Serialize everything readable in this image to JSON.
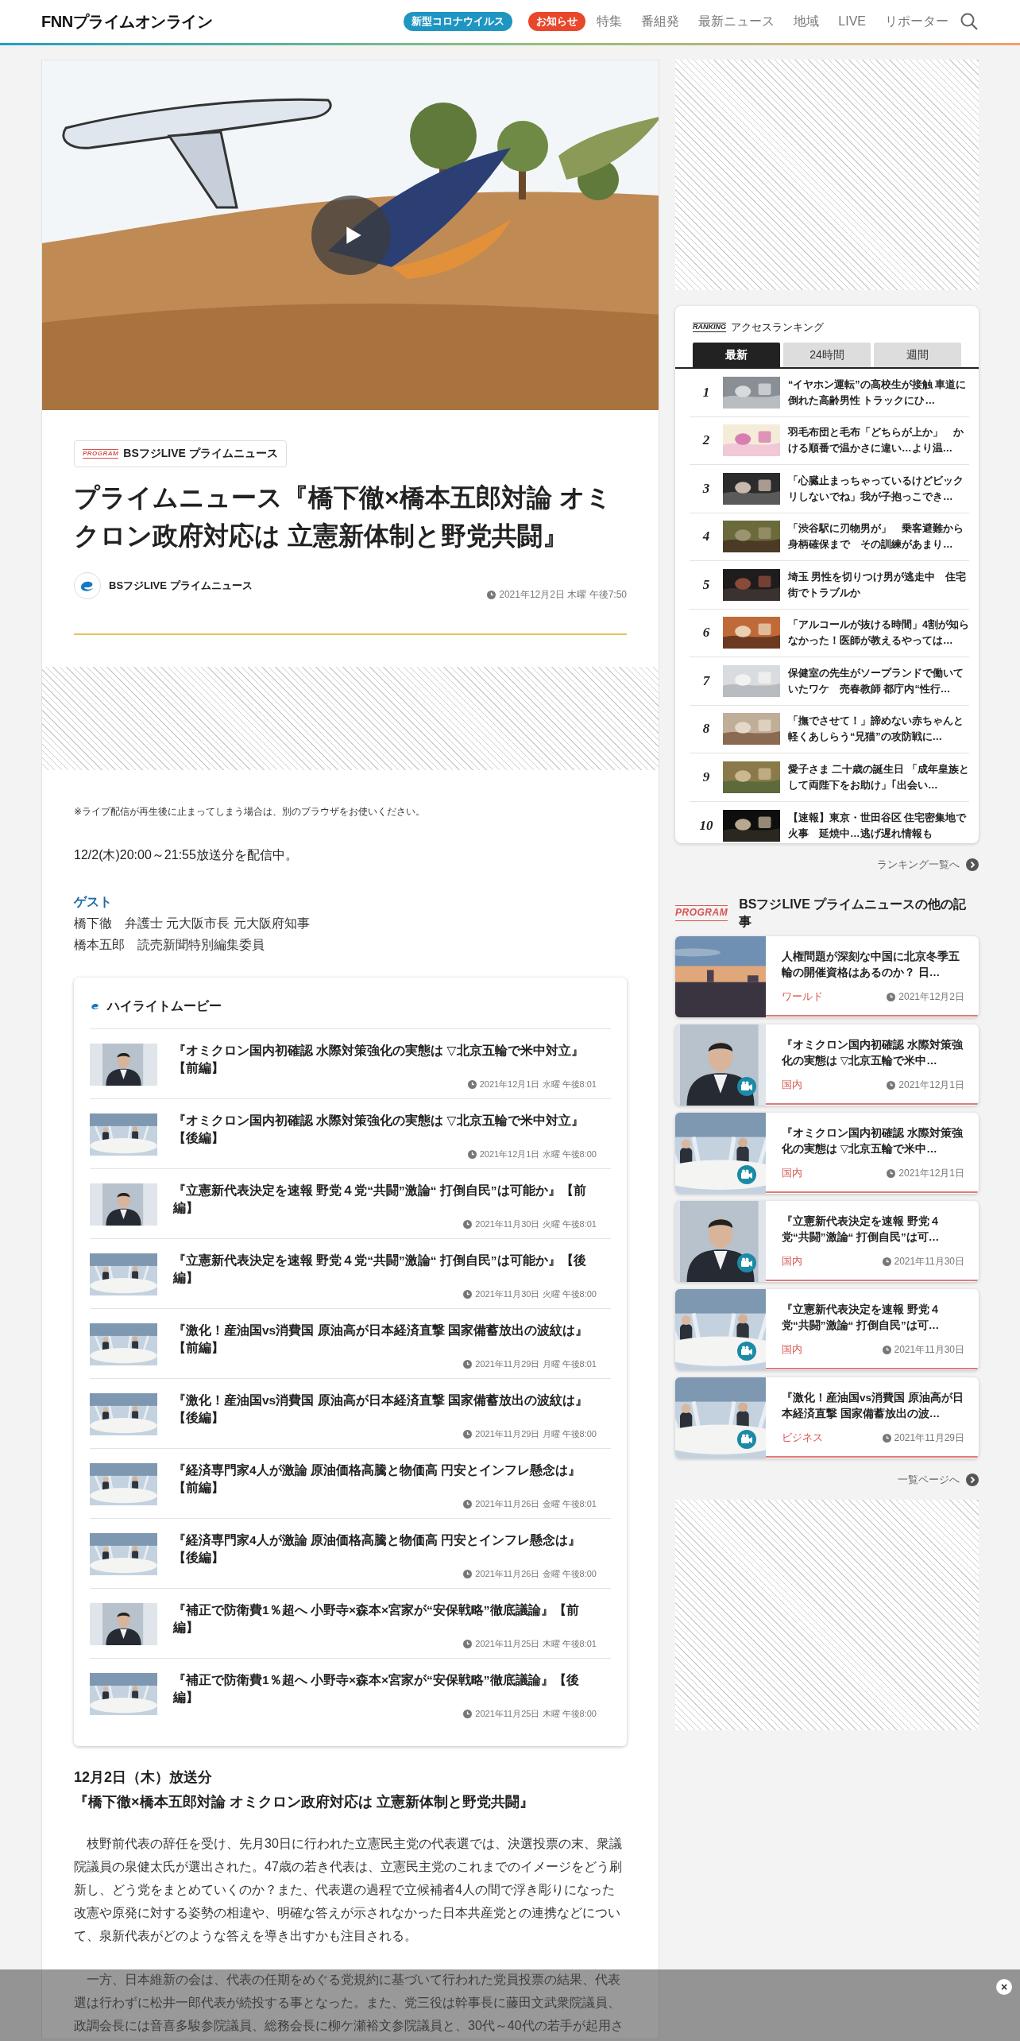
{
  "header": {
    "logo": "FNNプライムオンライン",
    "badges": [
      {
        "label": "新型コロナウイルス",
        "color": "#1f95c2"
      },
      {
        "label": "お知らせ",
        "color": "#e9472b"
      }
    ],
    "nav": [
      "特集",
      "番組発",
      "最新ニュース",
      "地域",
      "LIVE",
      "リポーター"
    ]
  },
  "article": {
    "program_badge": "PROGRAM",
    "program_name": "BSフジLIVE プライムニュース",
    "title": "プライムニュース『橋下徹×橋本五郎対論 オミクロン政府対応は 立憲新体制と野党共闘』",
    "author": "BSフジLIVE プライムニュース",
    "date": "2021年12月2日 木曜 午後7:50",
    "notice": "※ライブ配信が再生後に止まってしまう場合は、別のブラウザをお使いください。",
    "broadcast": "12/2(木)20:00～21:55放送分を配信中。",
    "guest_heading": "ゲスト",
    "guests": [
      "橋下徹　弁護士 元大阪市長 元大阪府知事",
      "橋本五郎　読売新聞特別編集委員"
    ],
    "highlight": {
      "title": "ハイライトムービー",
      "items": [
        {
          "title": "『オミクロン国内初確認 水際対策強化の実態は ▽北京五輪で米中対立』【前編】",
          "date": "2021年12月1日 水曜 午後8:01"
        },
        {
          "title": "『オミクロン国内初確認 水際対策強化の実態は ▽北京五輪で米中対立』【後編】",
          "date": "2021年12月1日 水曜 午後8:00"
        },
        {
          "title": "『立憲新代表決定を速報 野党４党“共闘”激論“ 打倒自民”は可能か』【前編】",
          "date": "2021年11月30日 火曜 午後8:01"
        },
        {
          "title": "『立憲新代表決定を速報 野党４党“共闘”激論“ 打倒自民”は可能か』【後編】",
          "date": "2021年11月30日 火曜 午後8:00"
        },
        {
          "title": "『激化！産油国vs消費国 原油高が日本経済直撃 国家備蓄放出の波紋は』【前編】",
          "date": "2021年11月29日 月曜 午後8:01"
        },
        {
          "title": "『激化！産油国vs消費国 原油高が日本経済直撃 国家備蓄放出の波紋は』【後編】",
          "date": "2021年11月29日 月曜 午後8:00"
        },
        {
          "title": "『経済専門家4人が激論 原油価格高騰と物価高 円安とインフレ懸念は』【前編】",
          "date": "2021年11月26日 金曜 午後8:01"
        },
        {
          "title": "『経済専門家4人が激論 原油価格高騰と物価高 円安とインフレ懸念は』【後編】",
          "date": "2021年11月26日 金曜 午後8:00"
        },
        {
          "title": "『補正で防衛費1％超へ 小野寺×森本×宮家が“安保戦略”徹底議論』【前編】",
          "date": "2021年11月25日 木曜 午後8:01"
        },
        {
          "title": "『補正で防衛費1％超へ 小野寺×森本×宮家が“安保戦略”徹底議論』【後編】",
          "date": "2021年11月25日 木曜 午後8:00"
        }
      ]
    },
    "section_heading": [
      "12月2日（木）放送分",
      "『橋下徹×橋本五郎対論 オミクロン政府対応は 立憲新体制と野党共闘』"
    ],
    "paragraphs": [
      "枝野前代表の辞任を受け、先月30日に行われた立憲民主党の代表選では、決選投票の末、衆議院議員の泉健太氏が選出された。47歳の若き代表は、立憲民主党のこれまでのイメージをどう刷新し、どう党をまとめていくのか？また、代表選の過程で立候補者4人の間で浮き彫りになった改憲や原発に対する姿勢の相違や、明確な答えが示されなかった日本共産党との連携などについて、泉新代表がどのような答えを導き出すかも注目される。",
      "一方、日本維新の会は、代表の任期をめぐる党規約に基づいて行われた党員投票の結果、代表選は行わずに松井一郎代表が続投する事となった。また、党三役は幹事長に藤田文武衆院議員、政調会長には音喜多駿参院議員、総務会長に柳ケ瀬裕文参院議員と、30代～40代の若手が起用さ"
    ]
  },
  "ranking": {
    "badge": "RANKING",
    "title": "アクセスランキング",
    "tabs": [
      {
        "label": "最新",
        "selected": true
      },
      {
        "label": "24時間",
        "selected": false
      },
      {
        "label": "週間",
        "selected": false
      }
    ],
    "items": [
      {
        "rank": "1",
        "title": "“イヤホン運転”の高校生が接触 車道に倒れた高齢男性 トラックにひ…"
      },
      {
        "rank": "2",
        "title": "羽毛布団と毛布「どちらが上か」　かける順番で温かさに違い…より温…"
      },
      {
        "rank": "3",
        "title": "「心臓止まっちゃっているけどビックリしないでね」我が子抱っこでき…"
      },
      {
        "rank": "4",
        "title": "「渋谷駅に刃物男が」　乗客避難から身柄確保まで　その訓練があまり…"
      },
      {
        "rank": "5",
        "title": "埼玉 男性を切りつけ男が逃走中　住宅街でトラブルか"
      },
      {
        "rank": "6",
        "title": "「アルコールが抜ける時間」4割が知らなかった！医師が教えるやっては…"
      },
      {
        "rank": "7",
        "title": "保健室の先生がソープランドで働いていたワケ　売春教師 都庁内“性行…"
      },
      {
        "rank": "8",
        "title": "「撫でさせて！」諦めない赤ちゃんと軽くあしらう“兄猫”の攻防戦に…"
      },
      {
        "rank": "9",
        "title": "愛子さま 二十歳の誕生日 「成年皇族として両陛下をお助け」｢出会い…"
      },
      {
        "rank": "10",
        "title": "【速報】東京・世田谷区 住宅密集地で火事　延焼中…逃げ遅れ情報も"
      }
    ],
    "more": "ランキング一覧へ"
  },
  "program_articles": {
    "badge": "PROGRAM",
    "title": "BSフジLIVE プライムニュースの他の記事",
    "items": [
      {
        "title": "人権問題が深刻な中国に北京冬季五輪の開催資格はあるのか？ 日…",
        "category": "ワールド",
        "date": "2021年12月2日",
        "video": false
      },
      {
        "title": "『オミクロン国内初確認 水際対策強化の実態は ▽北京五輪で米中…",
        "category": "国内",
        "date": "2021年12月1日",
        "video": true
      },
      {
        "title": "『オミクロン国内初確認 水際対策強化の実態は ▽北京五輪で米中…",
        "category": "国内",
        "date": "2021年12月1日",
        "video": true
      },
      {
        "title": "『立憲新代表決定を速報 野党４党“共闘”激論“ 打倒自民”は可…",
        "category": "国内",
        "date": "2021年11月30日",
        "video": true
      },
      {
        "title": "『立憲新代表決定を速報 野党４党“共闘”激論“ 打倒自民”は可…",
        "category": "国内",
        "date": "2021年11月30日",
        "video": true
      },
      {
        "title": "『激化！産油国vs消費国 原油高が日本経済直撃 国家備蓄放出の波…",
        "category": "ビジネス",
        "date": "2021年11月29日",
        "video": true
      }
    ],
    "more": "一覧ページへ"
  },
  "overlay": {
    "close": "×"
  }
}
